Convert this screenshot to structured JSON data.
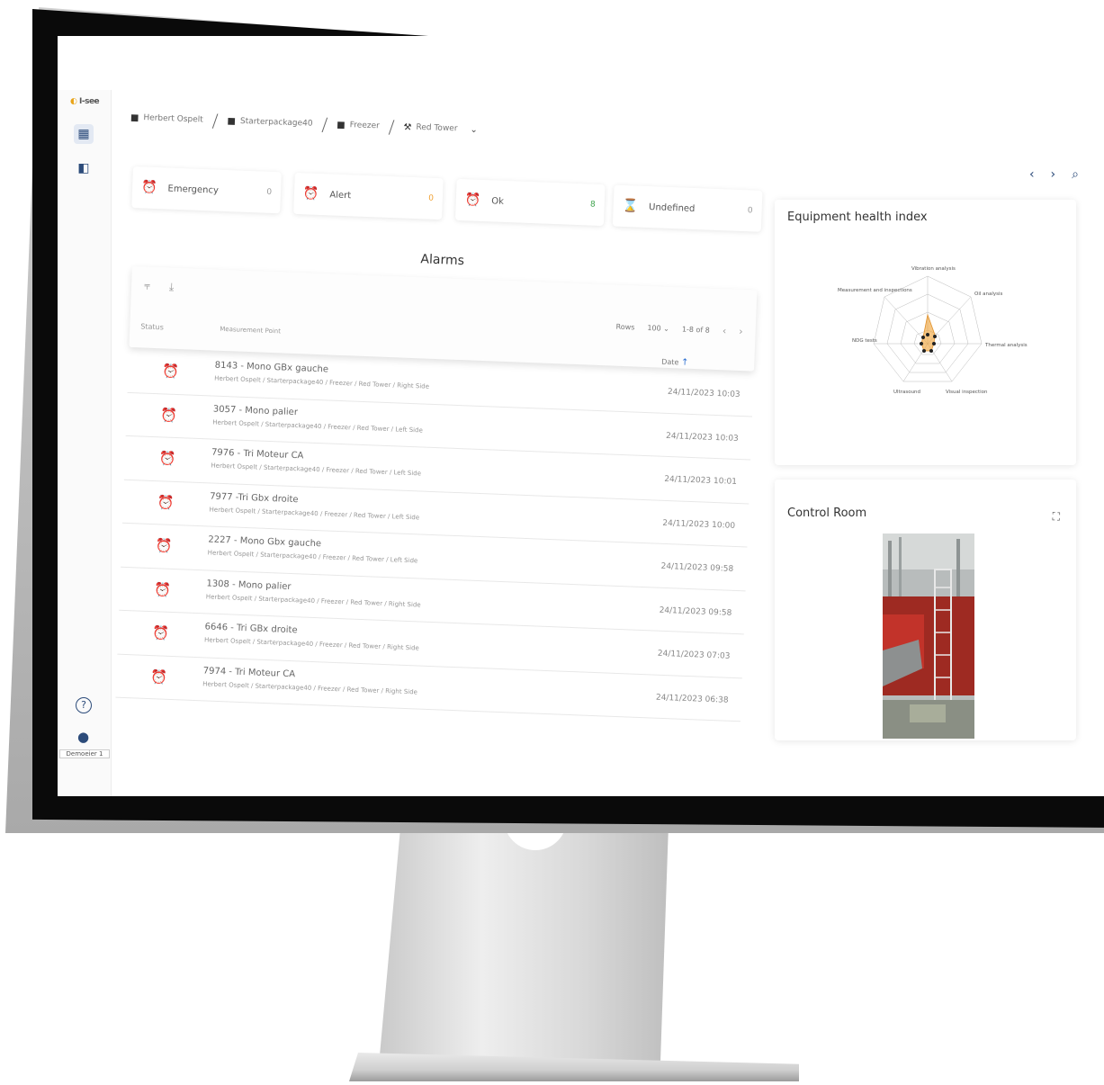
{
  "breadcrumb": [
    {
      "label": "Herbert Ospelt",
      "icon": "factory-icon"
    },
    {
      "label": "Starterpackage40",
      "icon": "factory-icon"
    },
    {
      "label": "Freezer",
      "icon": "factory-icon"
    },
    {
      "label": "Red Tower",
      "icon": "machine-icon"
    }
  ],
  "logo_text": "I-see",
  "status_cards": [
    {
      "label": "Emergency",
      "count": "0"
    },
    {
      "label": "Alert",
      "count": "0"
    },
    {
      "label": "Ok",
      "count": "8"
    },
    {
      "label": "Undefined",
      "count": "0"
    }
  ],
  "alarms": {
    "title": "Alarms",
    "rows_label": "Rows",
    "rows_value": "100",
    "range": "1-8 of 8",
    "columns": {
      "status": "Status",
      "measurement_point": "Measurement Point",
      "date": "Date"
    },
    "rows": [
      {
        "title": "8143 - Mono GBx gauche",
        "path": "Herbert Ospelt / Starterpackage40 / Freezer / Red Tower / Right Side",
        "date": "24/11/2023 10:03"
      },
      {
        "title": "3057 - Mono palier",
        "path": "Herbert Ospelt / Starterpackage40 / Freezer / Red Tower / Left Side",
        "date": "24/11/2023 10:03"
      },
      {
        "title": "7976 - Tri Moteur CA",
        "path": "Herbert Ospelt / Starterpackage40 / Freezer / Red Tower / Left Side",
        "date": "24/11/2023 10:01"
      },
      {
        "title": "7977 -Tri Gbx droite",
        "path": "Herbert Ospelt / Starterpackage40 / Freezer / Red Tower / Left Side",
        "date": "24/11/2023 10:00"
      },
      {
        "title": "2227 - Mono Gbx gauche",
        "path": "Herbert Ospelt / Starterpackage40 / Freezer / Red Tower / Left Side",
        "date": "24/11/2023 09:58"
      },
      {
        "title": "1308 - Mono palier",
        "path": "Herbert Ospelt / Starterpackage40 / Freezer / Red Tower / Right Side",
        "date": "24/11/2023 09:58"
      },
      {
        "title": "6646 - Tri GBx droite",
        "path": "Herbert Ospelt / Starterpackage40 / Freezer / Red Tower / Right Side",
        "date": "24/11/2023 07:03"
      },
      {
        "title": "7974 - Tri Moteur CA",
        "path": "Herbert Ospelt / Starterpackage40 / Freezer / Red Tower / Right Side",
        "date": "24/11/2023 06:38"
      }
    ]
  },
  "health": {
    "title": "Equipment health index",
    "axes": [
      "Vibration analysis",
      "Oil analysis",
      "Thermal analysis",
      "Visual inspection",
      "Ultrasound",
      "NDG tests",
      "Measurement and inspections"
    ]
  },
  "control_room": {
    "title": "Control Room"
  },
  "user_label": "Demoeier 1",
  "colors": {
    "accent": "#2c4b7a",
    "ok": "#3fa34d",
    "alert": "#f0a030",
    "emergency": "#d9534f"
  }
}
